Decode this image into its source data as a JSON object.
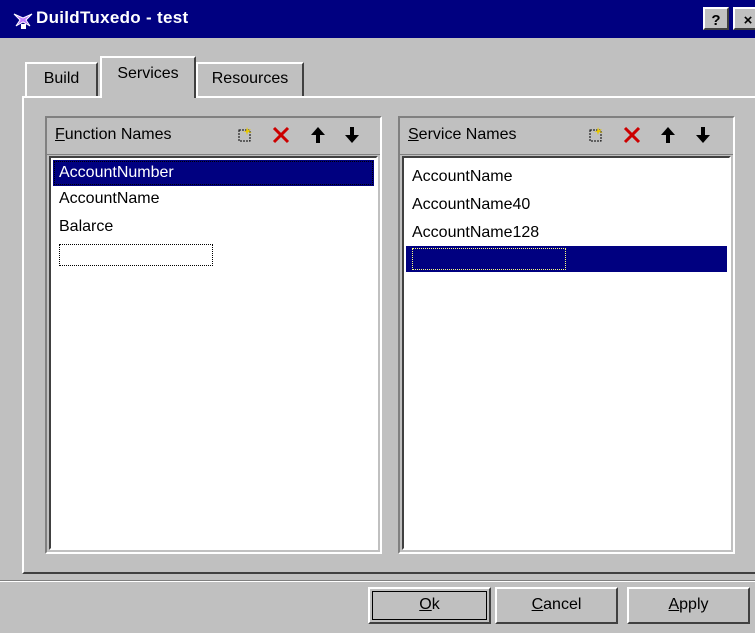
{
  "window": {
    "title": "DuildTuxedo - test",
    "help_label": "?",
    "close_label": "×"
  },
  "tabs": [
    {
      "label": "Build"
    },
    {
      "label": "Services"
    },
    {
      "label": "Resources"
    }
  ],
  "left_pane": {
    "header_underlined": "F",
    "header_rest": "unction Names",
    "items": [
      "AccountNumber",
      "AccountName",
      "Balarce"
    ]
  },
  "right_pane": {
    "header_underlined": "S",
    "header_rest": "ervice Names",
    "items": [
      "AccountName",
      "AccountName40",
      "AccountName128"
    ]
  },
  "buttons": {
    "ok_underlined": "O",
    "ok_rest": "k",
    "cancel_underlined": "C",
    "cancel_rest": "ancel",
    "apply_underlined": "A",
    "apply_rest": "pply"
  },
  "colors": {
    "title_bar": "#000080",
    "selection": "#000080",
    "face": "#c0c0c0",
    "delete_icon": "#cc0000"
  },
  "icons": [
    "app-icon",
    "new-item-icon",
    "delete-icon",
    "move-up-icon",
    "move-down-icon"
  ]
}
